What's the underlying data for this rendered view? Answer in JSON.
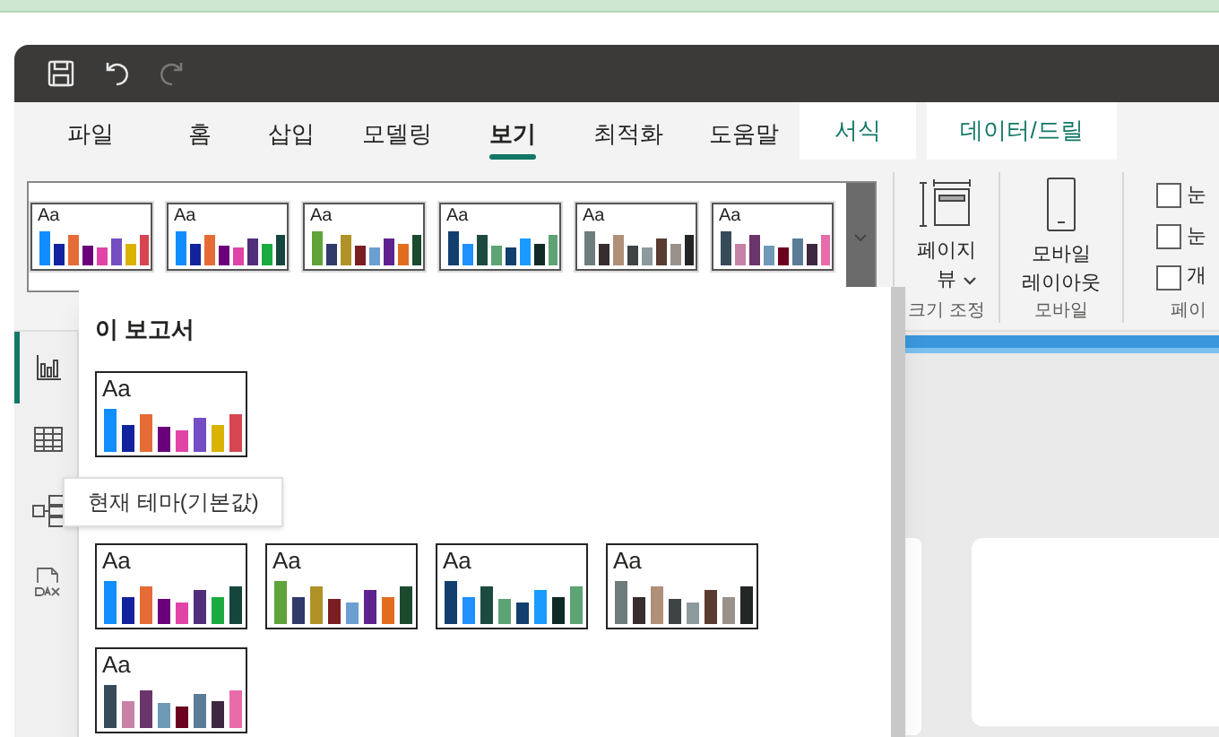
{
  "top_band": {
    "visible": true
  },
  "quick_access": [
    {
      "disabled": false
    },
    {
      "disabled": false
    },
    {
      "disabled": true
    }
  ],
  "tabs": [
    {
      "label": "파일",
      "selected": false,
      "kind": "standard"
    },
    {
      "label": "홈",
      "selected": false,
      "kind": "standard"
    },
    {
      "label": "삽입",
      "selected": false,
      "kind": "standard"
    },
    {
      "label": "모델링",
      "selected": false,
      "kind": "standard"
    },
    {
      "label": "보기",
      "selected": true,
      "kind": "standard"
    },
    {
      "label": "최적화",
      "selected": false,
      "kind": "standard"
    },
    {
      "label": "도움말",
      "selected": false,
      "kind": "standard"
    },
    {
      "label": "서식",
      "selected": false,
      "kind": "contextual"
    },
    {
      "label": "데이터/드릴",
      "selected": false,
      "kind": "contextual"
    }
  ],
  "ribbon": {
    "theme_gallery": [
      {
        "sample": "Aa",
        "bars": [
          {
            "color": "#118dff"
          },
          {
            "color": "#12239e"
          },
          {
            "color": "#e66c37"
          },
          {
            "color": "#6b007b"
          },
          {
            "color": "#e044a7"
          },
          {
            "color": "#744ec2"
          },
          {
            "color": "#d9b300"
          },
          {
            "color": "#d64550"
          }
        ]
      },
      {
        "sample": "Aa",
        "bars": [
          {
            "color": "#118dff"
          },
          {
            "color": "#12239e"
          },
          {
            "color": "#e66c37"
          },
          {
            "color": "#6b007b"
          },
          {
            "color": "#e044a7"
          },
          {
            "color": "#512e7c"
          },
          {
            "color": "#1aab40"
          },
          {
            "color": "#15463d"
          }
        ]
      },
      {
        "sample": "Aa",
        "bars": [
          {
            "color": "#5ea43a"
          },
          {
            "color": "#2f3a6a"
          },
          {
            "color": "#b09228"
          },
          {
            "color": "#7a1e24"
          },
          {
            "color": "#6b9ed1"
          },
          {
            "color": "#5f2390"
          },
          {
            "color": "#e36d1f"
          },
          {
            "color": "#1b4a2e"
          }
        ]
      },
      {
        "sample": "Aa",
        "bars": [
          {
            "color": "#123f6e"
          },
          {
            "color": "#1e90ff"
          },
          {
            "color": "#1d4a40"
          },
          {
            "color": "#5da374"
          },
          {
            "color": "#123f6e"
          },
          {
            "color": "#1a9bff"
          },
          {
            "color": "#0f2a26"
          },
          {
            "color": "#5da374"
          }
        ]
      },
      {
        "sample": "Aa",
        "bars": [
          {
            "color": "#6f7c7d"
          },
          {
            "color": "#362d2c"
          },
          {
            "color": "#b09078"
          },
          {
            "color": "#3e4346"
          },
          {
            "color": "#8c9a9d"
          },
          {
            "color": "#5a3b32"
          },
          {
            "color": "#9a918a"
          },
          {
            "color": "#232626"
          }
        ]
      },
      {
        "sample": "Aa",
        "bars": [
          {
            "color": "#374a5a"
          },
          {
            "color": "#c783a7"
          },
          {
            "color": "#6a356a"
          },
          {
            "color": "#6f9ab7"
          },
          {
            "color": "#6b0020"
          },
          {
            "color": "#5b7c96"
          },
          {
            "color": "#3e2740"
          },
          {
            "color": "#e86ca9"
          }
        ]
      }
    ],
    "page_view": {
      "label": "페이지 뷰",
      "group": "크기 조정"
    },
    "mobile_layout": {
      "label": "모바일 레이아웃",
      "group": "모바일"
    },
    "checkboxes": [
      {
        "label": "눈",
        "checked": false
      },
      {
        "label": "눈",
        "checked": false
      },
      {
        "label": "개",
        "checked": false
      }
    ],
    "checkbox_group": "페이"
  },
  "nav_rail": [
    {
      "selected": true
    },
    {
      "selected": false
    },
    {
      "selected": false
    },
    {
      "selected": false
    }
  ],
  "theme_dropdown": {
    "sections": [
      {
        "heading": "이 보고서",
        "themes": [
          {
            "sample": "Aa",
            "bars": [
              {
                "color": "#118dff"
              },
              {
                "color": "#12239e"
              },
              {
                "color": "#e66c37"
              },
              {
                "color": "#6b007b"
              },
              {
                "color": "#e044a7"
              },
              {
                "color": "#744ec2"
              },
              {
                "color": "#d9b300"
              },
              {
                "color": "#d64550"
              }
            ]
          }
        ]
      },
      {
        "themes": [
          {
            "sample": "Aa",
            "bars": [
              {
                "color": "#118dff"
              },
              {
                "color": "#12239e"
              },
              {
                "color": "#e66c37"
              },
              {
                "color": "#6b007b"
              },
              {
                "color": "#e044a7"
              },
              {
                "color": "#512e7c"
              },
              {
                "color": "#1aab40"
              },
              {
                "color": "#15463d"
              }
            ]
          },
          {
            "sample": "Aa",
            "bars": [
              {
                "color": "#5ea43a"
              },
              {
                "color": "#2f3a6a"
              },
              {
                "color": "#b09228"
              },
              {
                "color": "#7a1e24"
              },
              {
                "color": "#6b9ed1"
              },
              {
                "color": "#5f2390"
              },
              {
                "color": "#e36d1f"
              },
              {
                "color": "#1b4a2e"
              }
            ]
          },
          {
            "sample": "Aa",
            "bars": [
              {
                "color": "#123f6e"
              },
              {
                "color": "#1e90ff"
              },
              {
                "color": "#1d4a40"
              },
              {
                "color": "#5da374"
              },
              {
                "color": "#123f6e"
              },
              {
                "color": "#1a9bff"
              },
              {
                "color": "#0f2a26"
              },
              {
                "color": "#5da374"
              }
            ]
          },
          {
            "sample": "Aa",
            "bars": [
              {
                "color": "#6f7c7d"
              },
              {
                "color": "#362d2c"
              },
              {
                "color": "#b09078"
              },
              {
                "color": "#3e4346"
              },
              {
                "color": "#8c9a9d"
              },
              {
                "color": "#5a3b32"
              },
              {
                "color": "#9a918a"
              },
              {
                "color": "#232626"
              }
            ]
          },
          {
            "sample": "Aa",
            "bars": [
              {
                "color": "#374a5a"
              },
              {
                "color": "#c783a7"
              },
              {
                "color": "#6a356a"
              },
              {
                "color": "#6f9ab7"
              },
              {
                "color": "#6b0020"
              },
              {
                "color": "#5b7c96"
              },
              {
                "color": "#3e2740"
              },
              {
                "color": "#e86ca9"
              }
            ]
          }
        ]
      }
    ],
    "tooltip": "현재 테마(기본값)"
  }
}
